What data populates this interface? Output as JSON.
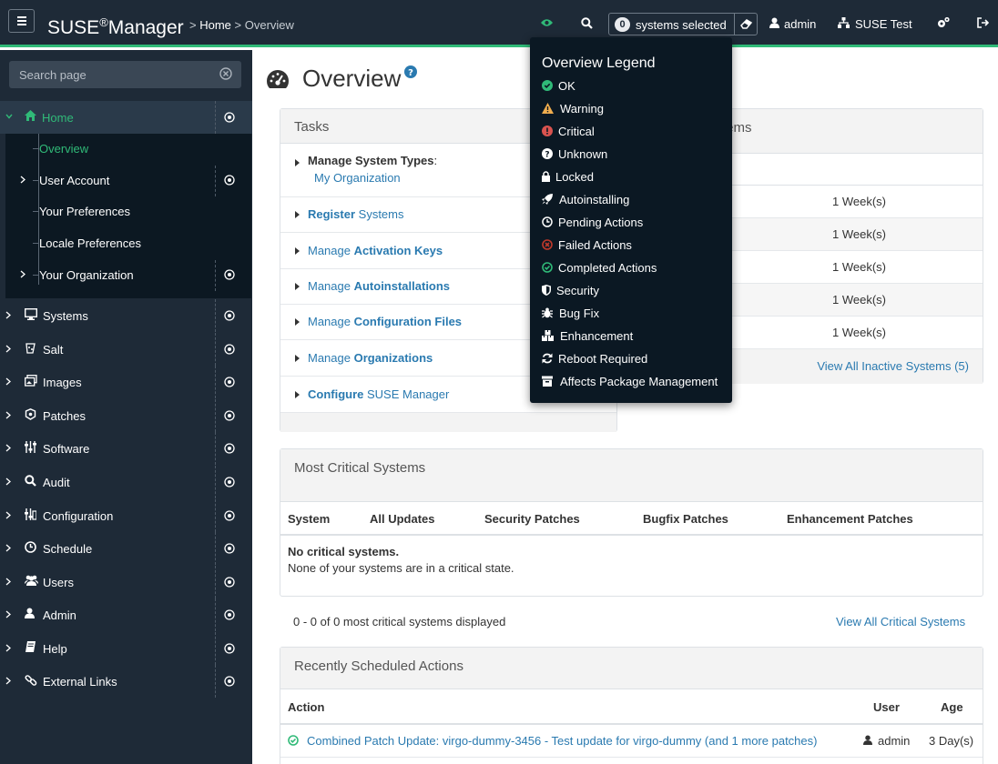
{
  "header": {
    "brand_prefix": "SUSE",
    "brand_mark": "®",
    "brand_suffix": "Manager",
    "crumb_sep1": ">",
    "crumb_home": "Home",
    "crumb_sep2": ">",
    "crumb_page": "Overview",
    "systems_count": "0",
    "systems_selected_label": "systems selected",
    "user": "admin",
    "organization": "SUSE Test"
  },
  "sidebar": {
    "search_placeholder": "Search page",
    "home": {
      "label": "Home",
      "children": [
        "Overview",
        "User Account",
        "Your Preferences",
        "Locale Preferences",
        "Your Organization"
      ]
    },
    "items": [
      "Systems",
      "Salt",
      "Images",
      "Patches",
      "Software",
      "Audit",
      "Configuration",
      "Schedule",
      "Users",
      "Admin",
      "Help",
      "External Links"
    ]
  },
  "page": {
    "title": "Overview"
  },
  "tasks": {
    "title": "Tasks",
    "manage_system_types_label": "Manage System Types",
    "manage_system_types_colon": ":",
    "my_organization": "My Organization",
    "register": [
      "Register",
      " Systems"
    ],
    "activation_keys": [
      "Manage ",
      "Activation Keys"
    ],
    "autoinstallations": [
      "Manage ",
      "Autoinstallations"
    ],
    "configuration_files": [
      "Manage ",
      "Configuration Files"
    ],
    "organizations": [
      "Manage ",
      "Organizations"
    ],
    "configure": [
      "Configure",
      " SUSE Manager"
    ]
  },
  "inactive": {
    "title_partial": "tems",
    "ages": [
      "1 Week(s)",
      "1 Week(s)",
      "1 Week(s)",
      "1 Week(s)",
      "1 Week(s)"
    ],
    "view_all": "View All Inactive Systems (5)"
  },
  "critical": {
    "title": "Most Critical Systems",
    "columns": [
      "System",
      "All Updates",
      "Security Patches",
      "Bugfix Patches",
      "Enhancement Patches"
    ],
    "empty_title": "No critical systems.",
    "empty_text": "None of your systems are in a critical state.",
    "summary": "0 - 0 of 0 most critical systems displayed",
    "view_all": "View All Critical Systems"
  },
  "scheduled": {
    "title": "Recently Scheduled Actions",
    "columns": [
      "Action",
      "User",
      "Age"
    ],
    "row": {
      "action": "Combined Patch Update: virgo-dummy-3456 - Test update for virgo-dummy (and 1 more patches)",
      "user": "admin",
      "age": "3 Day(s)"
    }
  },
  "legend": {
    "title": "Overview Legend",
    "items": [
      {
        "label": "OK",
        "icon": "check-circle-icon"
      },
      {
        "label": "Warning",
        "icon": "warning-icon"
      },
      {
        "label": "Critical",
        "icon": "critical-icon"
      },
      {
        "label": "Unknown",
        "icon": "question-circle-icon"
      },
      {
        "label": "Locked",
        "icon": "lock-icon"
      },
      {
        "label": "Autoinstalling",
        "icon": "rocket-icon"
      },
      {
        "label": "Pending Actions",
        "icon": "clock-icon"
      },
      {
        "label": "Failed Actions",
        "icon": "failed-circle-icon"
      },
      {
        "label": "Completed Actions",
        "icon": "completed-circle-icon"
      },
      {
        "label": "Security",
        "icon": "shield-icon"
      },
      {
        "label": "Bug Fix",
        "icon": "bug-icon"
      },
      {
        "label": "Enhancement",
        "icon": "boxes-icon"
      },
      {
        "label": "Reboot Required",
        "icon": "refresh-icon"
      },
      {
        "label": "Affects Package Management",
        "icon": "archive-icon"
      }
    ]
  },
  "colors": {
    "header_bg": "#1e2a37",
    "accent_green": "#30ba78",
    "link_blue": "#2a7ab0",
    "warning": "#f0ad4e",
    "critical": "#d9534f",
    "failed": "#c0392b"
  }
}
